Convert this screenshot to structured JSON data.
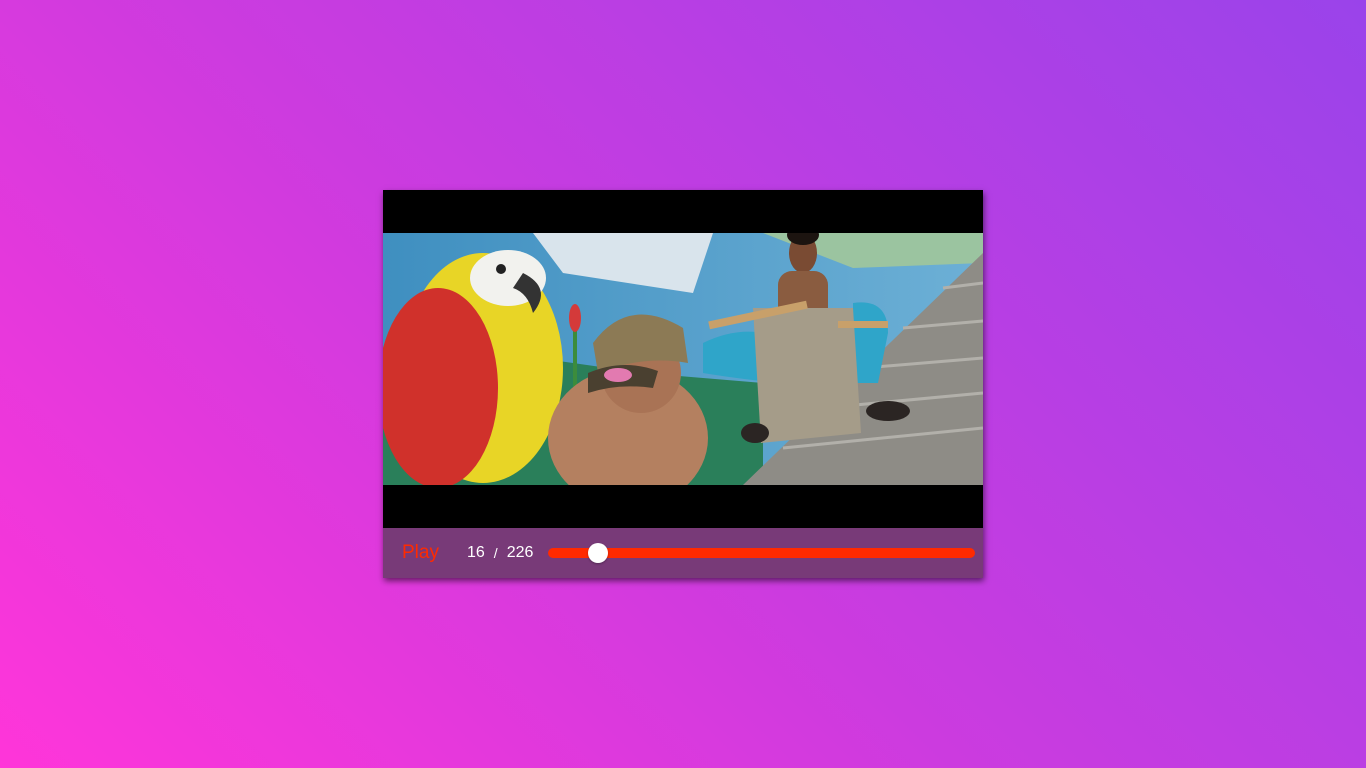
{
  "player": {
    "play_label": "Play",
    "current_time": "16",
    "separator": "/",
    "duration": "226",
    "progress_fraction": 0.0708,
    "colors": {
      "accent": "#ff2a00",
      "control_bar": "#783a78",
      "thumb": "#ffffff"
    }
  }
}
